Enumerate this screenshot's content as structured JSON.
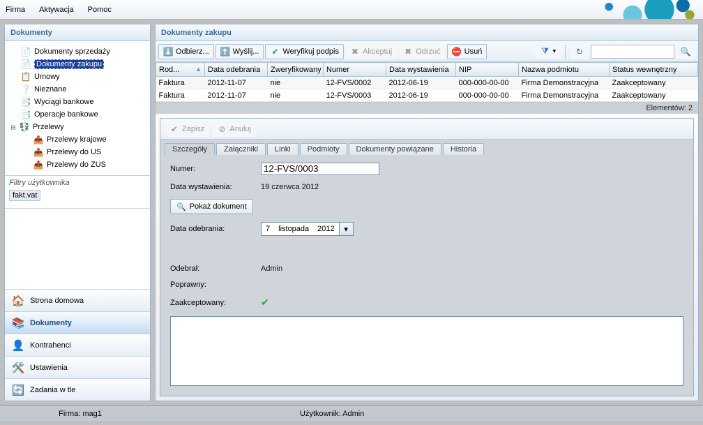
{
  "menu": {
    "firma": "Firma",
    "aktywacja": "Aktywacja",
    "pomoc": "Pomoc"
  },
  "sidebar": {
    "title": "Dokumenty",
    "tree": {
      "sprzedazy": "Dokumenty sprzedaży",
      "zakupu": "Dokumenty zakupu",
      "umowy": "Umowy",
      "nieznane": "Nieznane",
      "wyciagi": "Wyciągi bankowe",
      "operacje": "Operacje bankowe",
      "przelewy": "Przelewy",
      "przelewy_krajowe": "Przelewy krajowe",
      "przelewy_us": "Przelewy do US",
      "przelewy_zus": "Przelewy do ZUS"
    },
    "filters_title": "Filtry użytkownika",
    "filters_chip": "fakt.vat",
    "nav": {
      "home": "Strona domowa",
      "docs": "Dokumenty",
      "kontr": "Kontrahenci",
      "ustaw": "Ustawienia",
      "zadania": "Zadania w tle"
    }
  },
  "main": {
    "title": "Dokumenty zakupu",
    "toolbar": {
      "odbierz": "Odbierz...",
      "wyslij": "Wyślij...",
      "weryfikuj": "Weryfikuj podpis",
      "akceptuj": "Akceptuj",
      "odrzuc": "Odrzuć",
      "usun": "Usuń"
    },
    "columns": {
      "rodzaj": "Rod...",
      "data_odebrania": "Data odebrania",
      "zwer": "Zweryfikowany",
      "numer": "Numer",
      "data_wyst": "Data wystawienia",
      "nip": "NIP",
      "nazwa": "Nazwa podmiotu",
      "status": "Status wewnętrzny"
    },
    "rows": [
      {
        "rodzaj": "Faktura",
        "data_odebrania": "2012-11-07",
        "zwer": "nie",
        "numer": "12-FVS/0002",
        "data_wyst": "2012-06-19",
        "nip": "000-000-00-00",
        "nazwa": "Firma Demonstracyjna",
        "status": "Zaakceptowany"
      },
      {
        "rodzaj": "Faktura",
        "data_odebrania": "2012-11-07",
        "zwer": "nie",
        "numer": "12-FVS/0003",
        "data_wyst": "2012-06-19",
        "nip": "000-000-00-00",
        "nazwa": "Firma Demonstracyjna",
        "status": "Zaakceptowany"
      }
    ],
    "elements": "Elementów: 2"
  },
  "detail": {
    "zapisz": "Zapisz",
    "anuluj": "Anuluj",
    "tabs": {
      "szcz": "Szczegóły",
      "zal": "Załączniki",
      "linki": "Linki",
      "podm": "Podmioty",
      "dokpow": "Dokumenty powiązane",
      "hist": "Historia"
    },
    "labels": {
      "numer": "Numer:",
      "data_wyst": "Data wystawienia:",
      "pokaz": "Pokaż dokument",
      "data_odebr": "Data odebrania:",
      "odebral": "Odebrał:",
      "poprawny": "Poprawny:",
      "zaakc": "Zaakceptowany:"
    },
    "values": {
      "numer": "12-FVS/0003",
      "data_wyst": "19 czerwca 2012",
      "date_day": "7",
      "date_month": "listopada",
      "date_year": "2012",
      "odebral": "Admin"
    }
  },
  "status": {
    "firma": "Firma: mag1",
    "user": "Użytkownik: Admin"
  }
}
